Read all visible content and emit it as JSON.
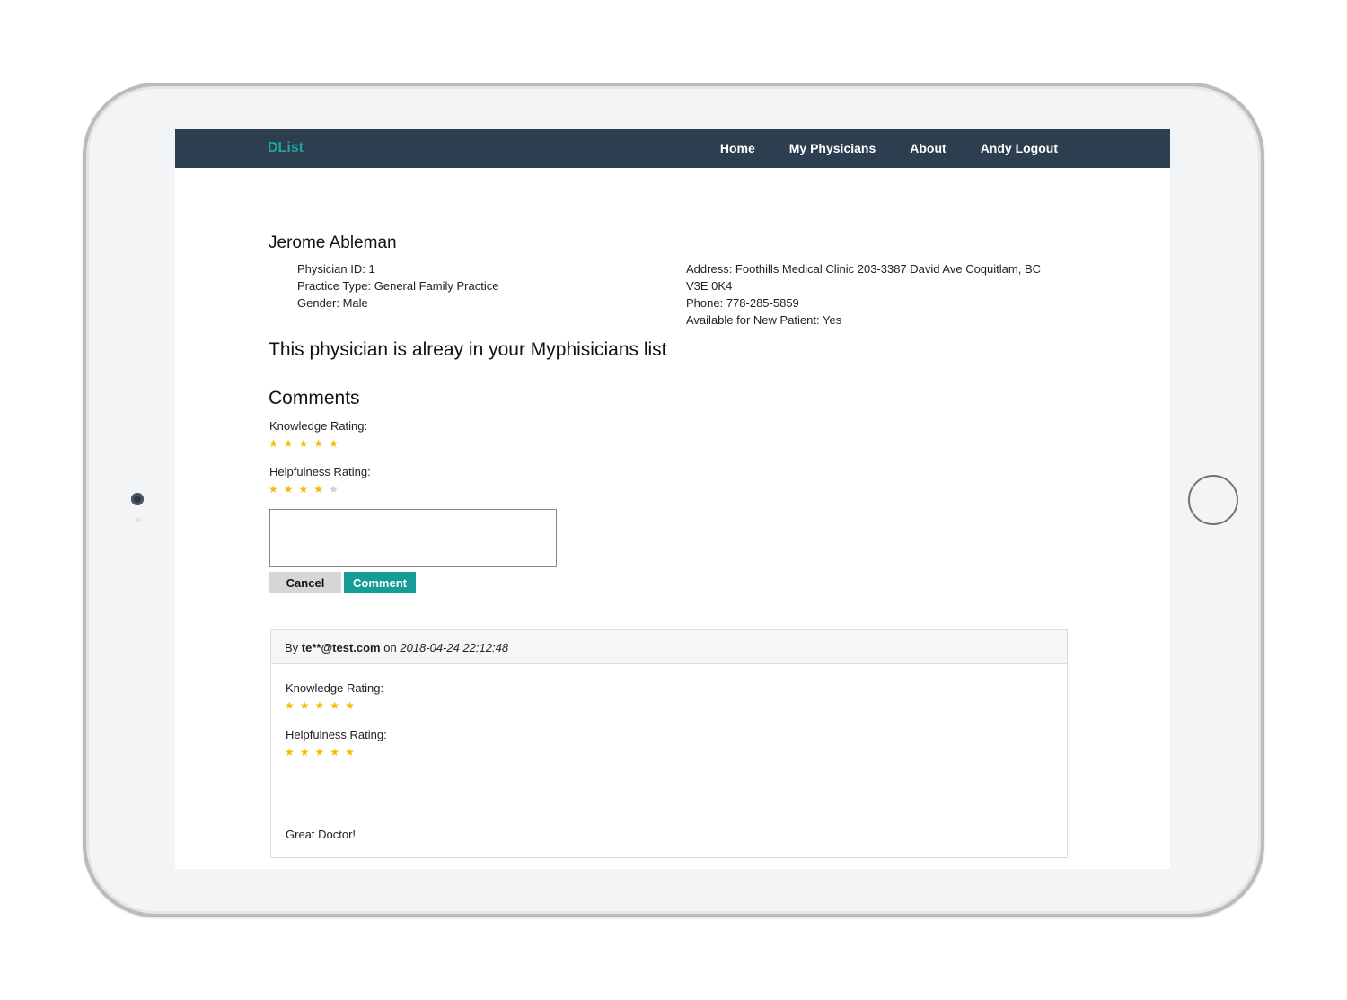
{
  "nav": {
    "brand": "DList",
    "links": [
      "Home",
      "My Physicians",
      "About",
      "Andy Logout"
    ]
  },
  "physician": {
    "name": "Jerome Ableman",
    "id_line": "Physician ID: 1",
    "practice_line": "Practice Type: General Family Practice",
    "gender_line": "Gender: Male",
    "address_line": "Address: Foothills Medical Clinic 203-3387 David Ave Coquitlam, BC V3E 0K4",
    "phone_line": "Phone: 778-285-5859",
    "available_line": "Available for New Patient: Yes"
  },
  "notice": "This physician is alreay in your Myphisicians list",
  "comments": {
    "heading": "Comments",
    "form": {
      "knowledge_label": "Knowledge Rating:",
      "knowledge_rating": 5,
      "helpfulness_label": "Helpfulness Rating:",
      "helpfulness_rating": 4,
      "textarea_value": "",
      "cancel_label": "Cancel",
      "comment_label": "Comment"
    },
    "items": [
      {
        "by_label": "By",
        "author": "te**@test.com",
        "on_label": "on",
        "date": "2018-04-24 22:12:48",
        "knowledge_label": "Knowledge Rating:",
        "knowledge_rating": 5,
        "helpfulness_label": "Helpfulness Rating:",
        "helpfulness_rating": 5,
        "text": "Great Doctor!"
      }
    ]
  },
  "colors": {
    "navbar": "#2d3e50",
    "brand": "#1aa6a1",
    "star_on": "#f7b900",
    "star_off": "#cfcfcf",
    "comment_button": "#149c95",
    "cancel_button": "#d6d6d6"
  },
  "icons": {
    "star": "star-icon",
    "star_empty": "star-empty-icon"
  }
}
